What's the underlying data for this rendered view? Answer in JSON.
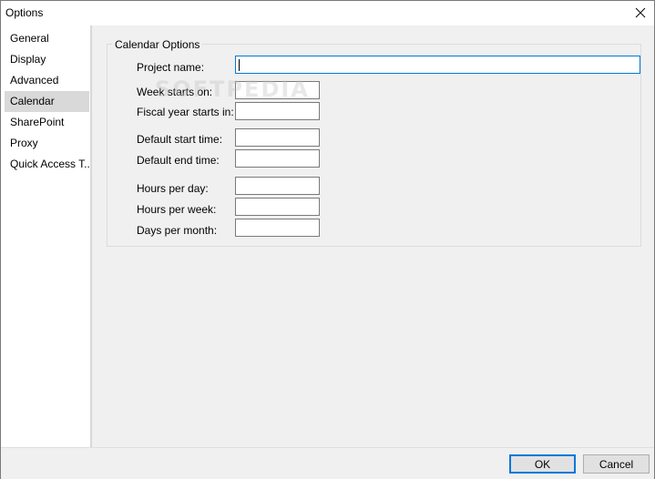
{
  "window": {
    "title": "Options",
    "close_icon": "close-icon"
  },
  "sidebar": {
    "items": [
      {
        "label": "General",
        "selected": false
      },
      {
        "label": "Display",
        "selected": false
      },
      {
        "label": "Advanced",
        "selected": false
      },
      {
        "label": "Calendar",
        "selected": true
      },
      {
        "label": "SharePoint",
        "selected": false
      },
      {
        "label": "Proxy",
        "selected": false
      },
      {
        "label": "Quick Access T...",
        "selected": false
      }
    ]
  },
  "calendar_options": {
    "group_title": "Calendar Options",
    "project_name": {
      "label": "Project name:",
      "value": ""
    },
    "week_starts_on": {
      "label": "Week starts on:",
      "value": ""
    },
    "fiscal_year_starts_in": {
      "label": "Fiscal year starts in:",
      "value": ""
    },
    "default_start_time": {
      "label": "Default start time:",
      "value": ""
    },
    "default_end_time": {
      "label": "Default end time:",
      "value": ""
    },
    "hours_per_day": {
      "label": "Hours per day:",
      "value": ""
    },
    "hours_per_week": {
      "label": "Hours per week:",
      "value": ""
    },
    "days_per_month": {
      "label": "Days per month:",
      "value": ""
    }
  },
  "footer": {
    "ok_label": "OK",
    "cancel_label": "Cancel"
  },
  "watermark": "SOFTPEDIA",
  "colors": {
    "accent": "#0078d7",
    "selected_item": "#d9d9d9",
    "panel_bg": "#f0f0f0"
  }
}
